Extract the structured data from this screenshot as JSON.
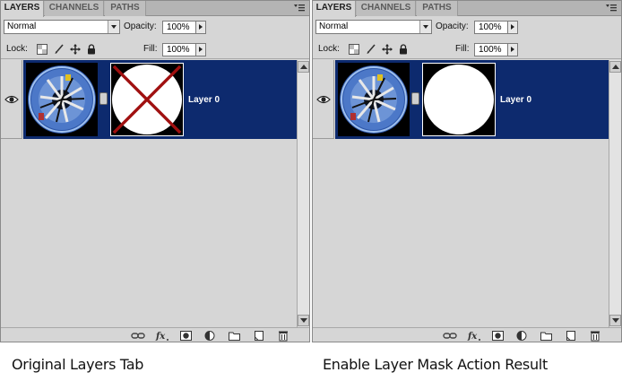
{
  "panels": [
    {
      "tabs": [
        "LAYERS",
        "CHANNELS",
        "PATHS"
      ],
      "blend_mode": "Normal",
      "opacity_label": "Opacity:",
      "opacity_value": "100%",
      "lock_label": "Lock:",
      "fill_label": "Fill:",
      "fill_value": "100%",
      "layer_name": "Layer 0",
      "mask_state": "disabled",
      "caption": "Original Layers Tab"
    },
    {
      "tabs": [
        "LAYERS",
        "CHANNELS",
        "PATHS"
      ],
      "blend_mode": "Normal",
      "opacity_label": "Opacity:",
      "opacity_value": "100%",
      "lock_label": "Lock:",
      "fill_label": "Fill:",
      "fill_value": "100%",
      "layer_name": "Layer 0",
      "mask_state": "enabled",
      "caption": "Enable Layer Mask Action Result"
    }
  ],
  "colors": {
    "selection": "#0d2a6e",
    "mask_disabled_x": "#a01010",
    "panel_bg": "#d6d6d6"
  },
  "icons": {
    "lock_icons": [
      "lock-transparent-icon",
      "lock-brush-icon",
      "lock-move-icon",
      "lock-all-icon"
    ],
    "bottom_icons": [
      "link-layers-icon",
      "fx-icon",
      "add-mask-icon",
      "adjustment-layer-icon",
      "new-group-icon",
      "new-layer-icon",
      "trash-icon"
    ]
  }
}
